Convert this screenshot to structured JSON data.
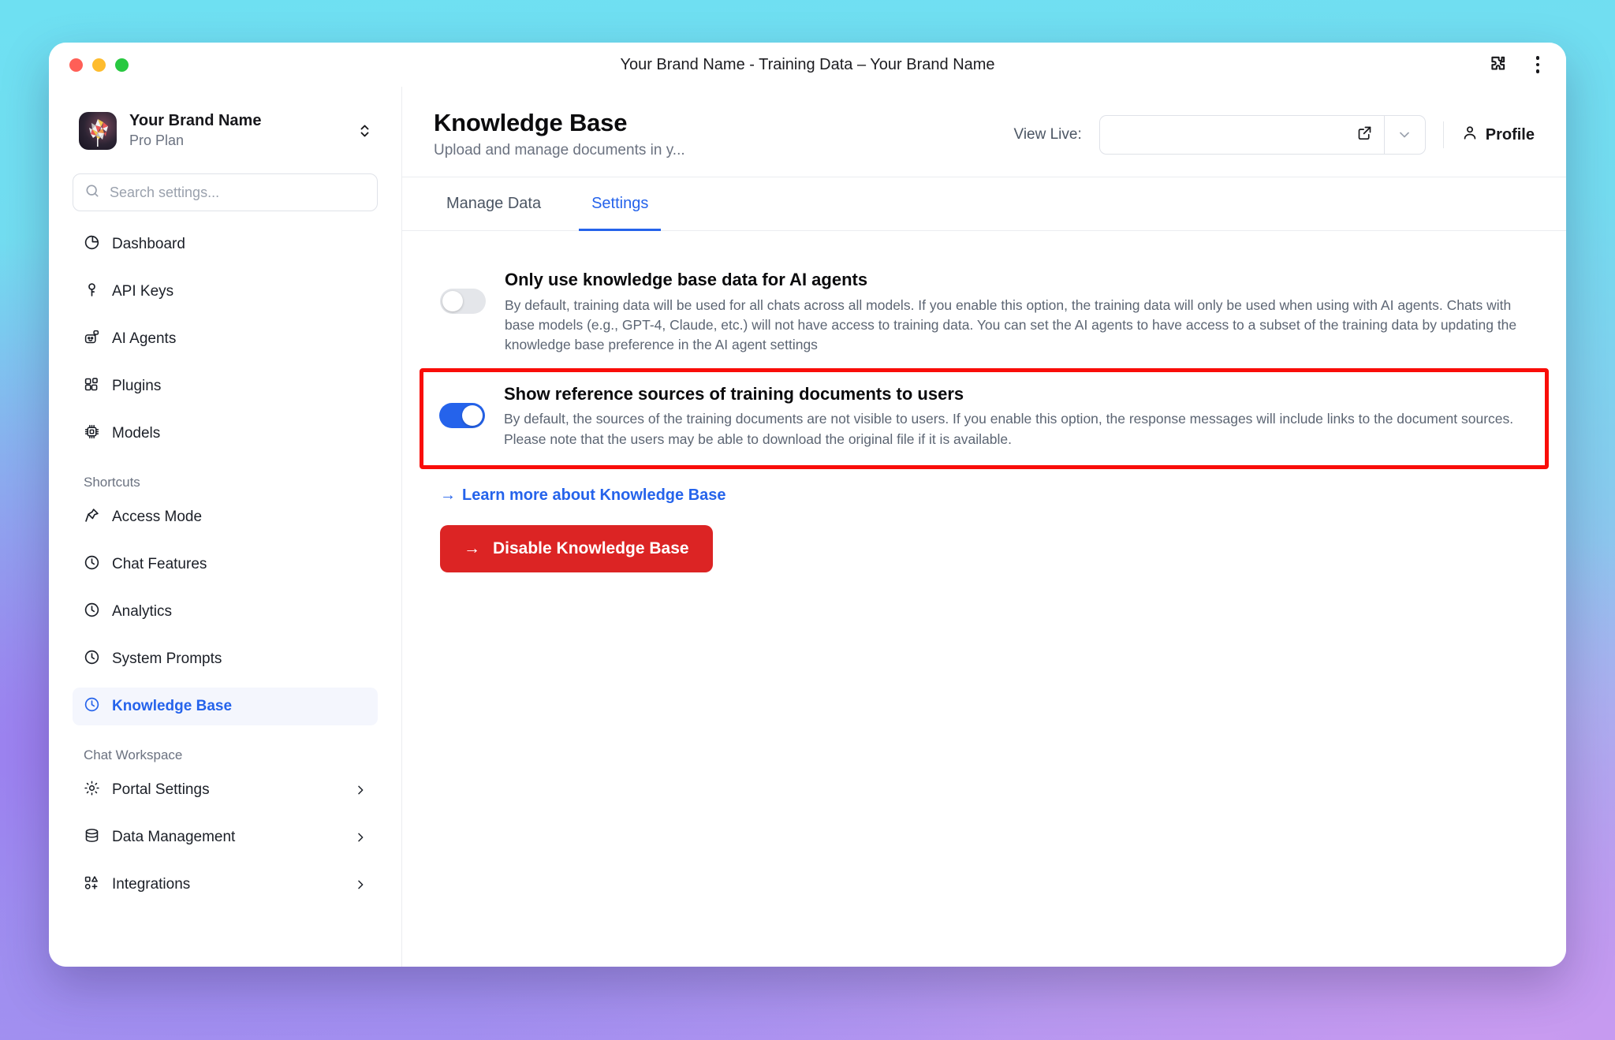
{
  "window": {
    "title": "Your Brand Name - Training Data – Your Brand Name",
    "extensions_icon": "puzzle-icon",
    "menu_icon": "kebab-menu-icon"
  },
  "sidebar": {
    "brand": {
      "name": "Your Brand Name",
      "plan": "Pro Plan",
      "logo_icon": "brain-logo-icon",
      "switcher_icon": "chevron-up-down-icon"
    },
    "search": {
      "placeholder": "Search settings...",
      "value": "",
      "icon": "search-icon"
    },
    "nav": [
      {
        "label": "Dashboard",
        "icon": "pie-chart-icon",
        "active": false,
        "chevron": false
      },
      {
        "label": "API Keys",
        "icon": "key-icon",
        "active": false,
        "chevron": false
      },
      {
        "label": "AI Agents",
        "icon": "robot-icon",
        "active": false,
        "chevron": false
      },
      {
        "label": "Plugins",
        "icon": "plugin-grid-icon",
        "active": false,
        "chevron": false
      },
      {
        "label": "Models",
        "icon": "chip-icon",
        "active": false,
        "chevron": false
      }
    ],
    "shortcuts_label": "Shortcuts",
    "shortcuts": [
      {
        "label": "Access Mode",
        "icon": "pin-icon",
        "active": false,
        "chevron": false
      },
      {
        "label": "Chat Features",
        "icon": "clock-icon",
        "active": false,
        "chevron": false
      },
      {
        "label": "Analytics",
        "icon": "clock-icon",
        "active": false,
        "chevron": false
      },
      {
        "label": "System Prompts",
        "icon": "clock-icon",
        "active": false,
        "chevron": false
      },
      {
        "label": "Knowledge Base",
        "icon": "clock-icon",
        "active": true,
        "chevron": false
      }
    ],
    "workspace_label": "Chat Workspace",
    "workspace": [
      {
        "label": "Portal Settings",
        "icon": "gear-icon",
        "active": false,
        "chevron": true
      },
      {
        "label": "Data Management",
        "icon": "database-icon",
        "active": false,
        "chevron": true
      },
      {
        "label": "Integrations",
        "icon": "integrations-icon",
        "active": false,
        "chevron": true
      }
    ]
  },
  "header": {
    "title": "Knowledge Base",
    "subtitle": "Upload and manage documents in y...",
    "view_live_label": "View Live:",
    "url_value": "",
    "url_placeholder": "",
    "external_link_icon": "external-link-icon",
    "dropdown_icon": "chevron-down-icon",
    "profile_label": "Profile",
    "profile_icon": "user-icon"
  },
  "tabs": [
    {
      "label": "Manage Data",
      "active": false
    },
    {
      "label": "Settings",
      "active": true
    }
  ],
  "settings": [
    {
      "title": "Only use knowledge base data for AI agents",
      "description": "By default, training data will be used for all chats across all models. If you enable this option, the training data will only be used when using with AI agents. Chats with base models (e.g., GPT-4, Claude, etc.) will not have access to training data. You can set the AI agents to have access to a subset of the training data by updating the knowledge base preference in the AI agent settings",
      "enabled": false,
      "highlighted": false
    },
    {
      "title": "Show reference sources of training documents to users",
      "description": "By default, the sources of the training documents are not visible to users. If you enable this option, the response messages will include links to the document sources. Please note that the users may be able to download the original file if it is available.",
      "enabled": true,
      "highlighted": true
    }
  ],
  "actions": {
    "learn_more_label": "Learn more about Knowledge Base",
    "learn_more_arrow": "→",
    "disable_label": "Disable Knowledge Base",
    "disable_arrow": "→"
  },
  "colors": {
    "accent": "#2563eb",
    "danger": "#dc2424",
    "highlight_border": "#f90d09",
    "toggle_off": "#e4e6ea"
  }
}
